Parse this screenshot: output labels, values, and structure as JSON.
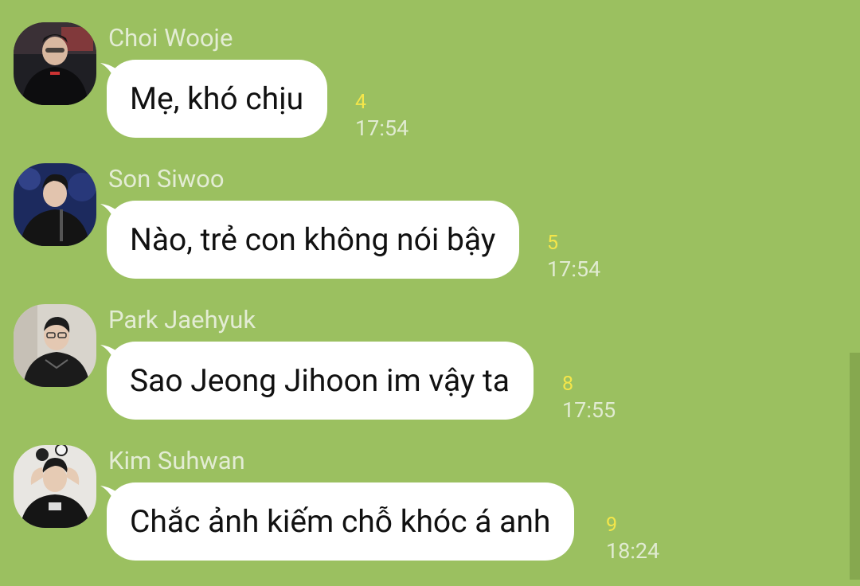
{
  "messages": [
    {
      "sender": "Choi Wooje",
      "text": "Mẹ, khó chịu",
      "unread": "4",
      "time": "17:54"
    },
    {
      "sender": "Son Siwoo",
      "text": "Nào, trẻ con không nói bậy",
      "unread": "5",
      "time": "17:54"
    },
    {
      "sender": "Park Jaehyuk",
      "text": "Sao Jeong Jihoon im vậy ta",
      "unread": "8",
      "time": "17:55"
    },
    {
      "sender": "Kim Suhwan",
      "text": "Chắc ảnh kiếm chỗ khóc á anh",
      "unread": "9",
      "time": "18:24"
    }
  ],
  "colors": {
    "background": "#9bc060",
    "bubble": "#ffffff",
    "unread": "#f4e64a",
    "scrollbar": "#86a84f"
  }
}
